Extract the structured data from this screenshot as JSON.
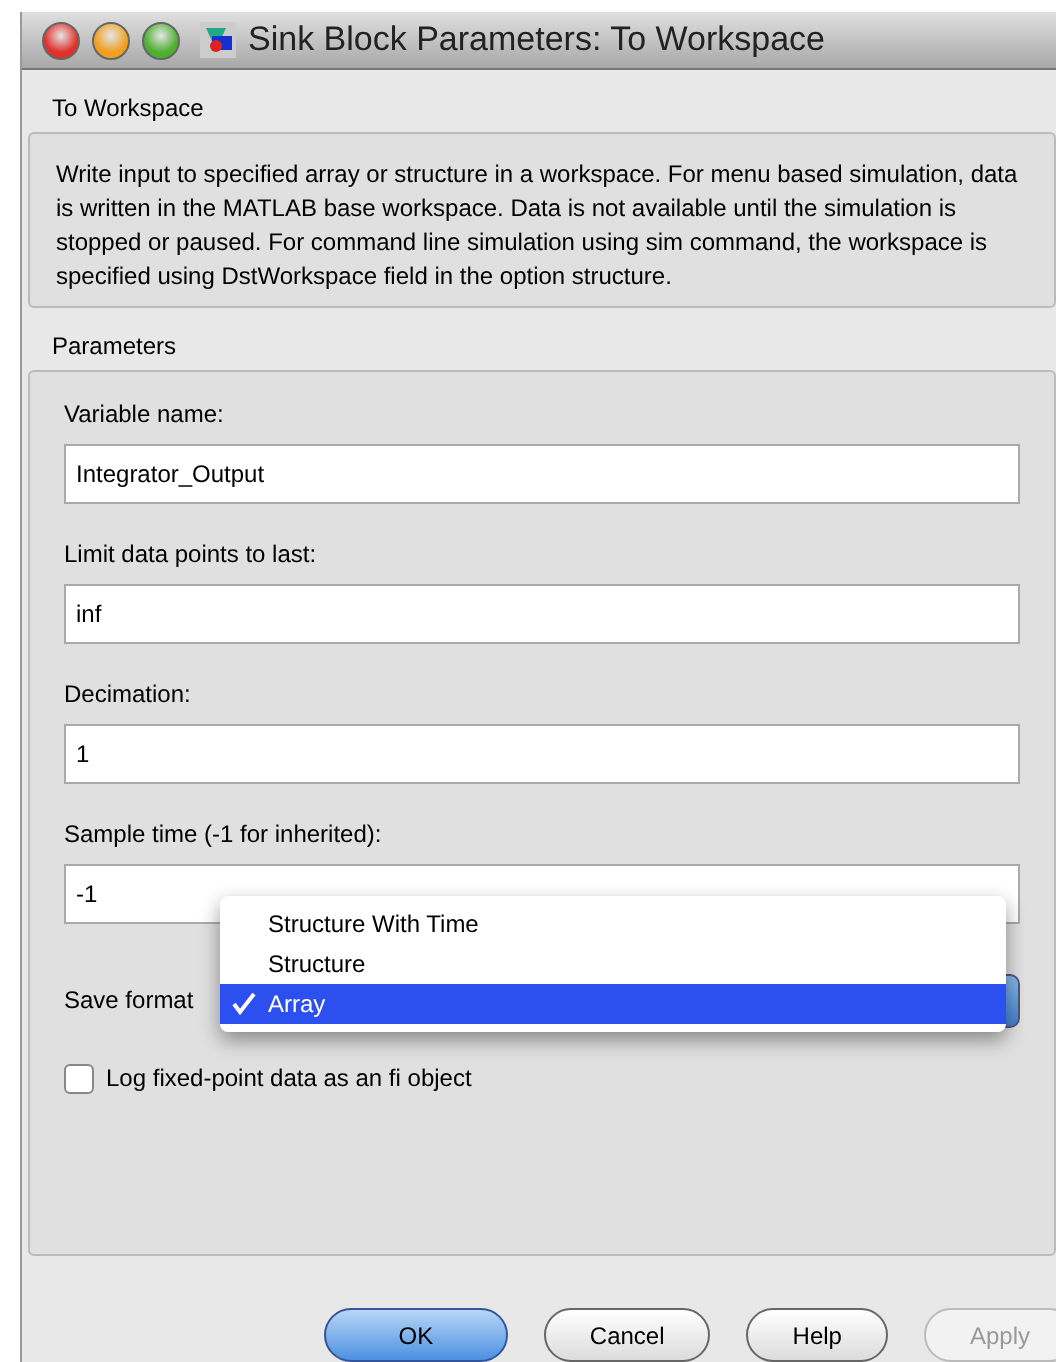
{
  "window": {
    "title": "Sink Block Parameters: To Workspace"
  },
  "block_name": "To Workspace",
  "description": "Write input to specified array or structure in a workspace. For menu based simulation, data is written in the MATLAB base workspace. Data is not available until the simulation is stopped or paused. For command line simulation using sim command, the workspace is specified using DstWorkspace field in the option structure.",
  "parameters_label": "Parameters",
  "fields": [
    {
      "label": "Variable name:",
      "value": "Integrator_Output"
    },
    {
      "label": "Limit data points to last:",
      "value": "inf"
    },
    {
      "label": "Decimation:",
      "value": "1"
    },
    {
      "label": "Sample time (-1 for inherited):",
      "value": "-1"
    }
  ],
  "save_format": {
    "label": "Save format",
    "options": [
      {
        "label": "Structure With Time",
        "selected": false
      },
      {
        "label": "Structure",
        "selected": false
      },
      {
        "label": "Array",
        "selected": true
      }
    ]
  },
  "checkbox": {
    "label": "Log fixed-point data as an fi object",
    "checked": false
  },
  "buttons": [
    {
      "label": "OK",
      "default": true,
      "disabled": false
    },
    {
      "label": "Cancel",
      "default": false,
      "disabled": false
    },
    {
      "label": "Help",
      "default": false,
      "disabled": false
    },
    {
      "label": "Apply",
      "default": false,
      "disabled": true
    }
  ]
}
